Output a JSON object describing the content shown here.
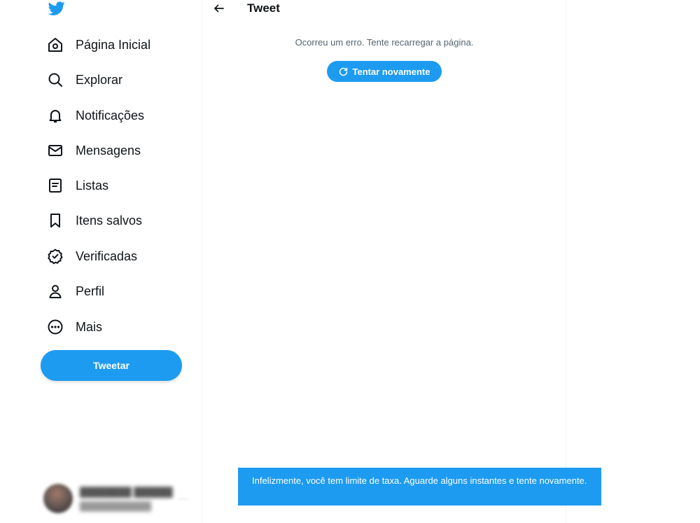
{
  "sidebar": {
    "logo_icon": "twitter-bird-icon",
    "items": [
      {
        "label": "Página Inicial",
        "icon": "home-icon"
      },
      {
        "label": "Explorar",
        "icon": "search-icon"
      },
      {
        "label": "Notificações",
        "icon": "bell-icon"
      },
      {
        "label": "Mensagens",
        "icon": "envelope-icon"
      },
      {
        "label": "Listas",
        "icon": "list-icon"
      },
      {
        "label": "Itens salvos",
        "icon": "bookmark-icon"
      },
      {
        "label": "Verificadas",
        "icon": "verified-badge-icon"
      },
      {
        "label": "Perfil",
        "icon": "person-icon"
      },
      {
        "label": "Mais",
        "icon": "more-circle-icon"
      }
    ],
    "tweet_button": "Tweetar"
  },
  "main": {
    "title": "Tweet",
    "error_message": "Ocorreu um erro. Tente recarregar a página.",
    "retry_button": "Tentar novamente"
  },
  "toast": {
    "message": "Infelizmente, você tem limite de taxa. Aguarde alguns instantes e tente novamente."
  },
  "colors": {
    "accent": "#1d9bf0",
    "text": "#0f1419",
    "muted": "#536471"
  }
}
